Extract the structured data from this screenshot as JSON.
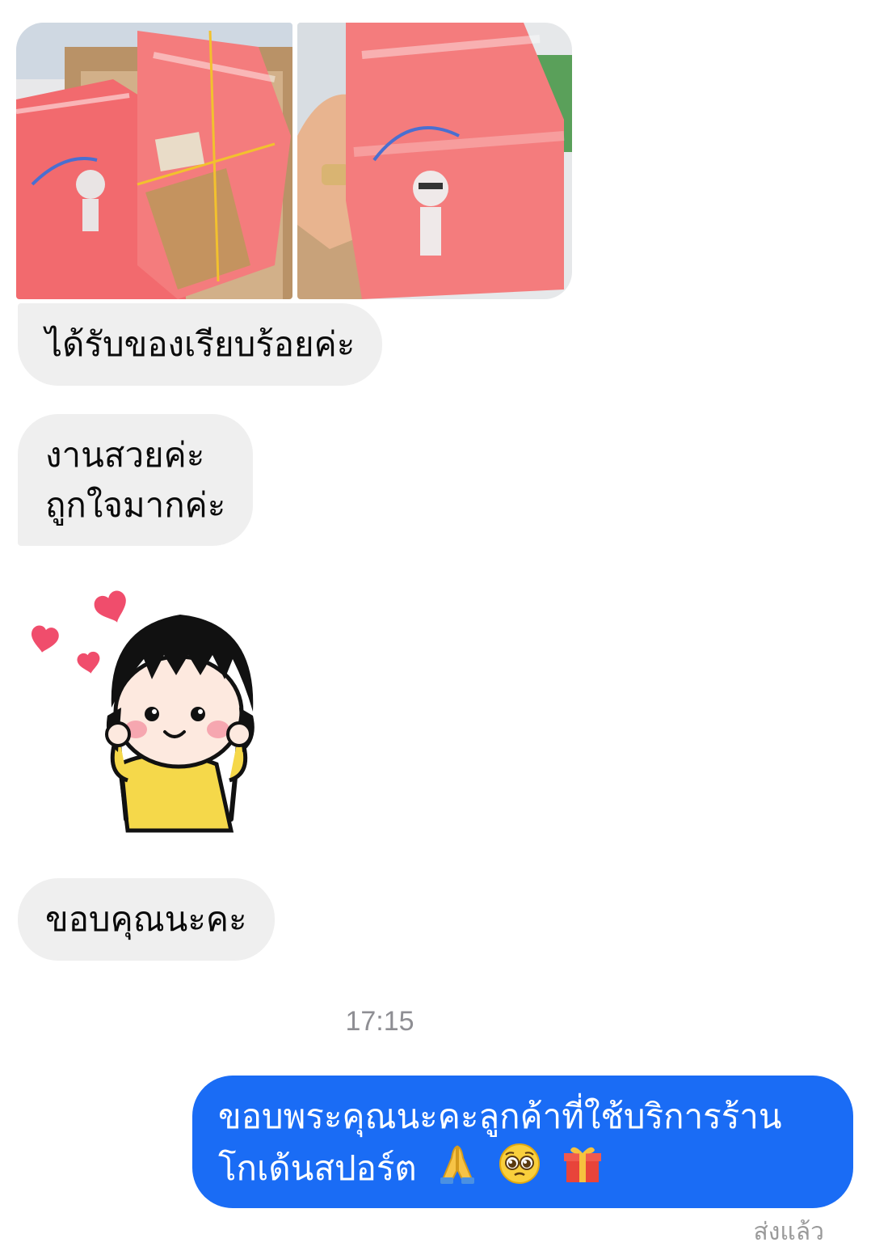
{
  "conversation": {
    "attachments": [
      {
        "name": "photo-shirts-box",
        "icon": "image"
      },
      {
        "name": "photo-shirts-hand",
        "icon": "image"
      }
    ],
    "incoming": [
      {
        "lines": [
          "ได้รับของเรียบร้อยค่ะ"
        ]
      },
      {
        "lines": [
          "งานสวยค่ะ",
          "ถูกใจมากค่ะ"
        ]
      },
      {
        "sticker": "girl-hearts-sticker"
      },
      {
        "lines": [
          "ขอบคุณนะคะ"
        ]
      }
    ],
    "timestamp": "17:15",
    "outgoing": {
      "lines": [
        "ขอบพระคุณนะคะลูกค้าที่ใช้บริการร้าน",
        "โกเด้นสปอร์ต"
      ],
      "emojis": [
        "praying-hands-icon",
        "pleading-face-icon",
        "gift-icon"
      ]
    },
    "status": "ส่งแล้ว"
  },
  "colors": {
    "incoming_bubble": "#efefef",
    "outgoing_bubble": "#1a6cf5",
    "timestamp": "#8e8e93"
  }
}
